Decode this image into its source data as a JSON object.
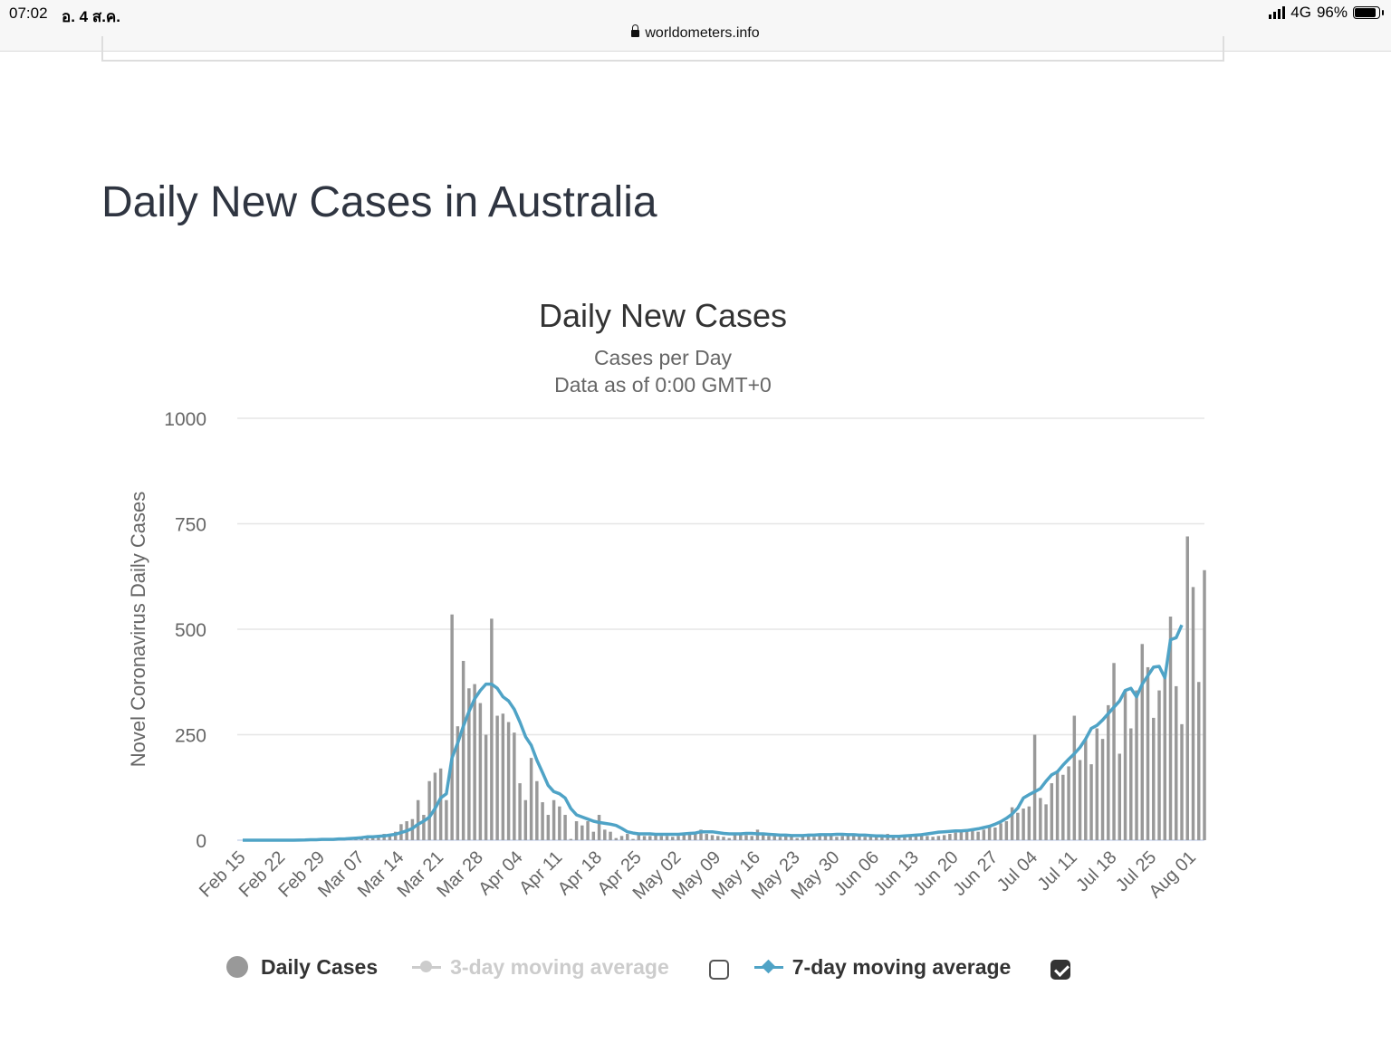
{
  "status_bar": {
    "time": "07:02",
    "date": "อ. 4 ส.ค.",
    "network": "4G",
    "battery": "96%",
    "battery_level": 0.96,
    "url": "worldometers.info"
  },
  "page": {
    "title": "Daily New Cases in Australia"
  },
  "chart_data": {
    "type": "bar",
    "title": "Daily New Cases",
    "subtitle_lines": [
      "Cases per Day",
      "Data as of 0:00 GMT+0"
    ],
    "ylabel": "Novel Coronavirus Daily Cases",
    "xlabel": "",
    "ylim": [
      0,
      1000
    ],
    "yticks": [
      0,
      250,
      500,
      750,
      1000
    ],
    "grid": true,
    "legend_position": "bottom",
    "x_tick_labels": [
      "Feb 15",
      "Feb 22",
      "Feb 29",
      "Mar 07",
      "Mar 14",
      "Mar 21",
      "Mar 28",
      "Apr 04",
      "Apr 11",
      "Apr 18",
      "Apr 25",
      "May 02",
      "May 09",
      "May 16",
      "May 23",
      "May 30",
      "Jun 06",
      "Jun 13",
      "Jun 20",
      "Jun 27",
      "Jul 04",
      "Jul 11",
      "Jul 18",
      "Jul 25",
      "Aug 01"
    ],
    "x_start": "Feb 15",
    "x_end": "Aug 03",
    "series": [
      {
        "name": "Daily Cases",
        "color": "#999999",
        "values": [
          0,
          0,
          0,
          0,
          0,
          0,
          0,
          0,
          0,
          0,
          1,
          0,
          0,
          0,
          0,
          1,
          2,
          1,
          3,
          3,
          4,
          4,
          8,
          5,
          6,
          15,
          10,
          20,
          38,
          45,
          50,
          95,
          60,
          140,
          160,
          170,
          95,
          535,
          270,
          425,
          360,
          370,
          325,
          250,
          525,
          295,
          300,
          280,
          255,
          135,
          95,
          195,
          140,
          90,
          60,
          95,
          80,
          60,
          3,
          45,
          35,
          45,
          20,
          60,
          25,
          20,
          5,
          10,
          15,
          3,
          15,
          10,
          10,
          15,
          10,
          10,
          8,
          10,
          15,
          18,
          20,
          25,
          15,
          12,
          10,
          8,
          5,
          12,
          15,
          12,
          10,
          25,
          15,
          10,
          12,
          8,
          15,
          8,
          5,
          12,
          10,
          8,
          10,
          12,
          15,
          8,
          10,
          12,
          15,
          10,
          8,
          12,
          10,
          12,
          15,
          8,
          12,
          10,
          8,
          10,
          12,
          10,
          8,
          10,
          12,
          15,
          18,
          20,
          22,
          25,
          20,
          25,
          35,
          30,
          40,
          45,
          78,
          65,
          75,
          80,
          250,
          100,
          85,
          135,
          165,
          155,
          175,
          295,
          190,
          240,
          180,
          265,
          240,
          320,
          420,
          205,
          355,
          265,
          355,
          465,
          410,
          290,
          355,
          390,
          530,
          365,
          275,
          720,
          600,
          375,
          640
        ]
      },
      {
        "name": "3-day moving average",
        "color": "#cccccc",
        "enabled": false
      },
      {
        "name": "7-day moving average",
        "color": "#4fa3c6",
        "enabled": true,
        "values": [
          0,
          0,
          0,
          0,
          0,
          0,
          0,
          0,
          0,
          0.1,
          0.3,
          0.5,
          1,
          1,
          2,
          2,
          2,
          3,
          3,
          4,
          5,
          6,
          8,
          8,
          9,
          10,
          12,
          14,
          18,
          22,
          28,
          38,
          45,
          55,
          75,
          100,
          110,
          195,
          230,
          270,
          305,
          335,
          355,
          370,
          370,
          360,
          340,
          330,
          310,
          280,
          245,
          225,
          190,
          160,
          130,
          115,
          110,
          100,
          75,
          60,
          55,
          50,
          45,
          42,
          40,
          38,
          35,
          28,
          20,
          17,
          15,
          15,
          15,
          14,
          14,
          14,
          14,
          14,
          15,
          16,
          17,
          20,
          20,
          20,
          18,
          16,
          15,
          15,
          15,
          16,
          16,
          15,
          15,
          14,
          13,
          12,
          12,
          11,
          11,
          11,
          12,
          12,
          13,
          13,
          13,
          14,
          14,
          13,
          13,
          12,
          12,
          11,
          10,
          10,
          9,
          9,
          9,
          10,
          11,
          12,
          13,
          15,
          17,
          19,
          20,
          21,
          22,
          22,
          23,
          25,
          27,
          30,
          33,
          38,
          44,
          52,
          62,
          76,
          100,
          108,
          115,
          122,
          140,
          155,
          162,
          178,
          192,
          205,
          220,
          240,
          265,
          272,
          285,
          300,
          315,
          330,
          355,
          360,
          340,
          370,
          390,
          410,
          412,
          385,
          475,
          480,
          510
        ]
      }
    ]
  },
  "legend": {
    "daily_cases": "Daily Cases",
    "ma3": "3-day moving average",
    "ma7": "7-day moving average"
  }
}
